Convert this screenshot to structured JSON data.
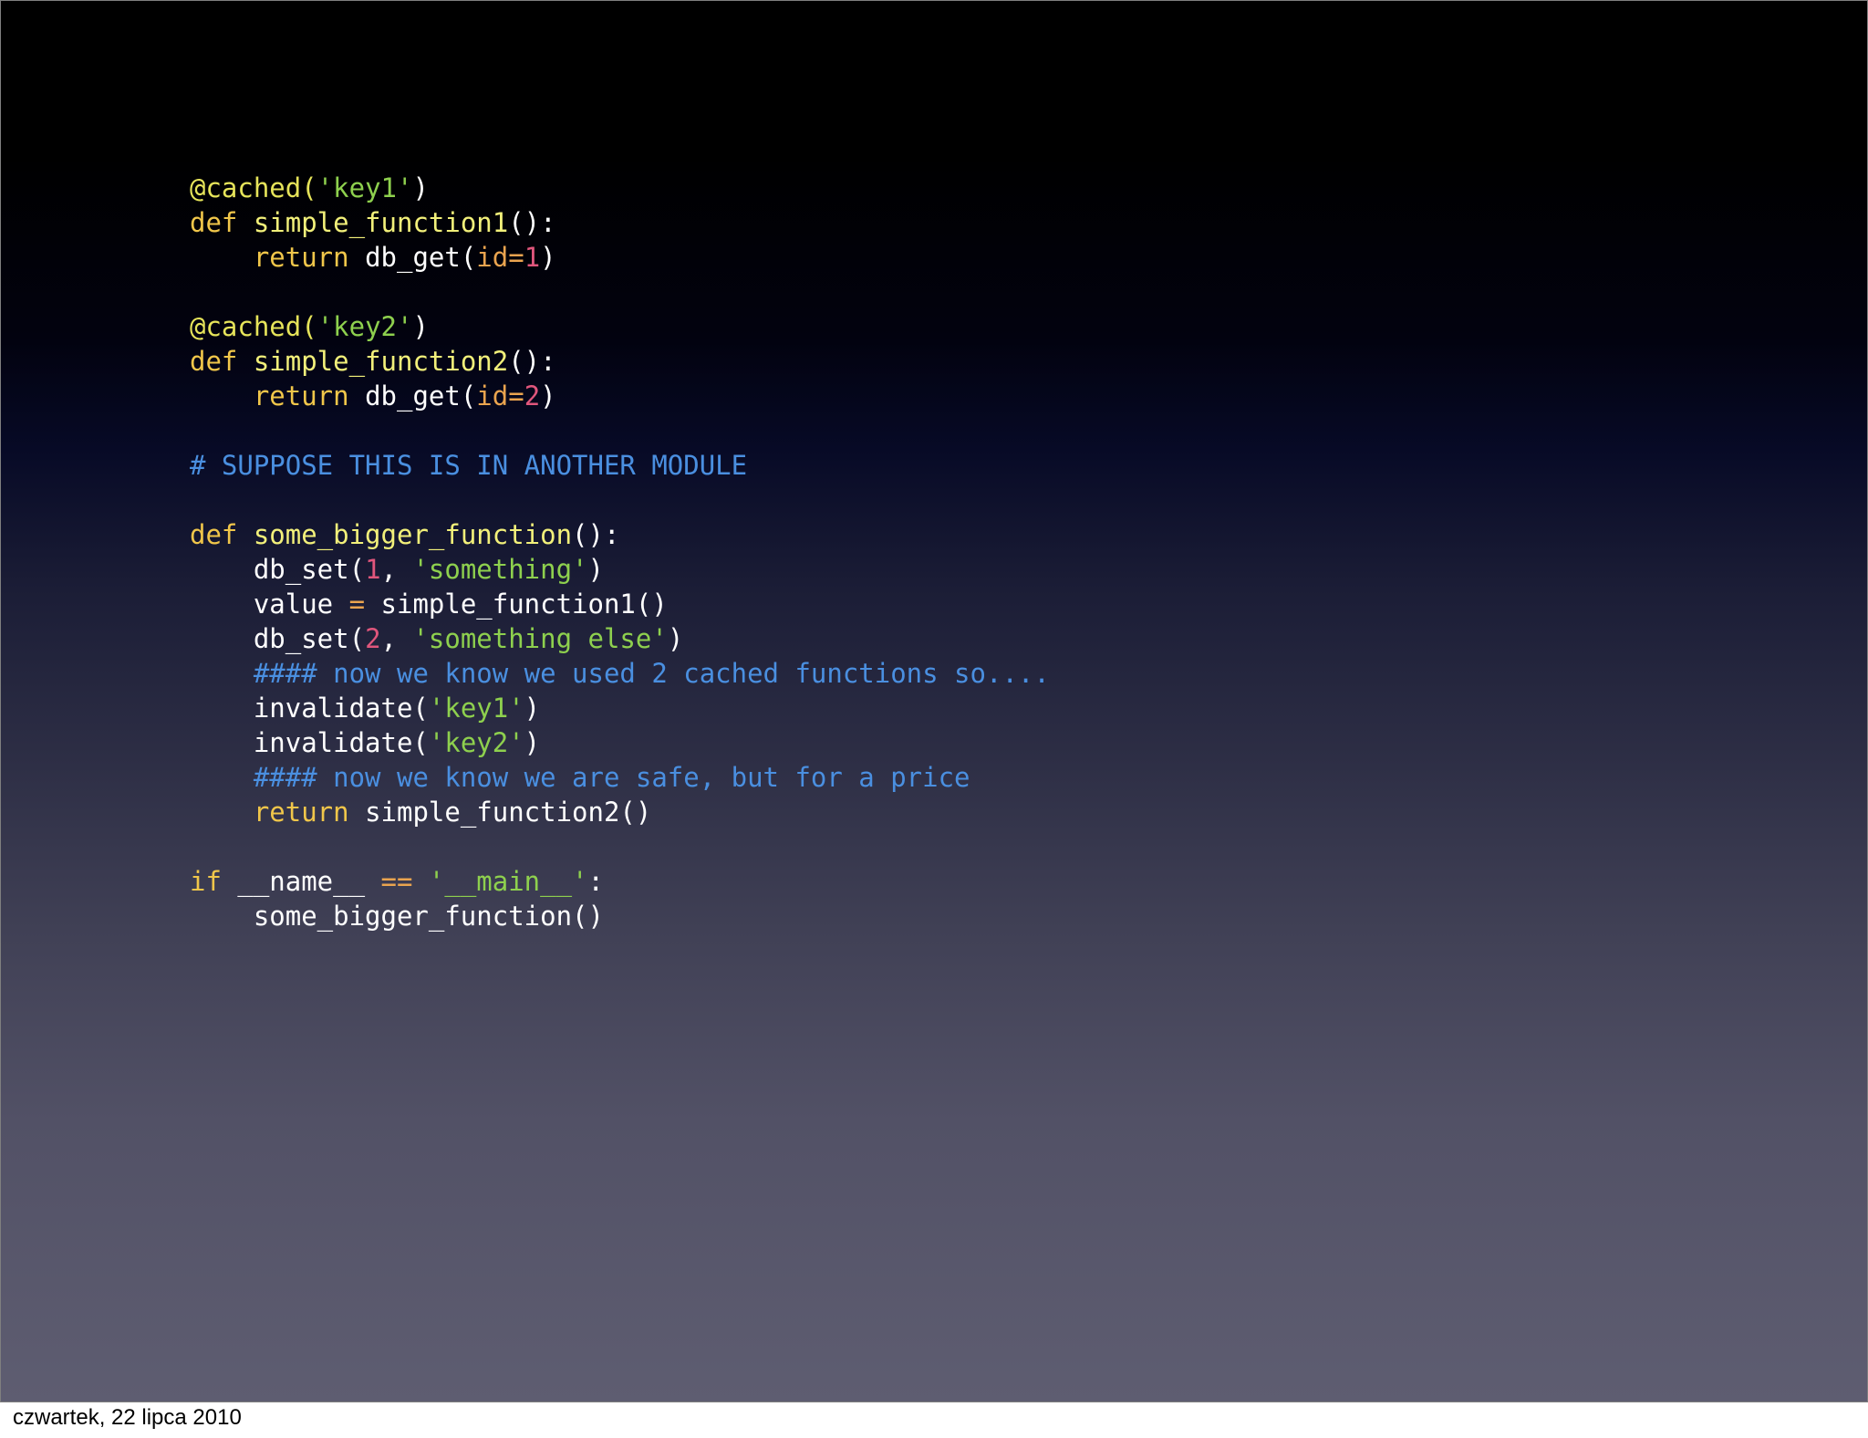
{
  "code_lines": [
    [
      {
        "t": "@cached(",
        "c": "decorator"
      },
      {
        "t": "'key1'",
        "c": "string"
      },
      {
        "t": ")",
        "c": "plain"
      }
    ],
    [
      {
        "t": "def ",
        "c": "keyword"
      },
      {
        "t": "simple_function1",
        "c": "funcdef"
      },
      {
        "t": "():",
        "c": "plain"
      }
    ],
    [
      {
        "t": "    ",
        "c": "plain"
      },
      {
        "t": "return",
        "c": "keyword"
      },
      {
        "t": " db_get(",
        "c": "plain"
      },
      {
        "t": "id=",
        "c": "param"
      },
      {
        "t": "1",
        "c": "number"
      },
      {
        "t": ")",
        "c": "plain"
      }
    ],
    [],
    [
      {
        "t": "@cached(",
        "c": "decorator"
      },
      {
        "t": "'key2'",
        "c": "string"
      },
      {
        "t": ")",
        "c": "plain"
      }
    ],
    [
      {
        "t": "def ",
        "c": "keyword"
      },
      {
        "t": "simple_function2",
        "c": "funcdef"
      },
      {
        "t": "():",
        "c": "plain"
      }
    ],
    [
      {
        "t": "    ",
        "c": "plain"
      },
      {
        "t": "return",
        "c": "keyword"
      },
      {
        "t": " db_get(",
        "c": "plain"
      },
      {
        "t": "id=",
        "c": "param"
      },
      {
        "t": "2",
        "c": "number"
      },
      {
        "t": ")",
        "c": "plain"
      }
    ],
    [],
    [
      {
        "t": "# SUPPOSE THIS IS IN ANOTHER MODULE",
        "c": "comment"
      }
    ],
    [],
    [
      {
        "t": "def ",
        "c": "keyword"
      },
      {
        "t": "some_bigger_function",
        "c": "funcdef"
      },
      {
        "t": "():",
        "c": "plain"
      }
    ],
    [
      {
        "t": "    db_set(",
        "c": "plain"
      },
      {
        "t": "1",
        "c": "number"
      },
      {
        "t": ", ",
        "c": "plain"
      },
      {
        "t": "'something'",
        "c": "string"
      },
      {
        "t": ")",
        "c": "plain"
      }
    ],
    [
      {
        "t": "    value ",
        "c": "plain"
      },
      {
        "t": "=",
        "c": "operator"
      },
      {
        "t": " simple_function1()",
        "c": "plain"
      }
    ],
    [
      {
        "t": "    db_set(",
        "c": "plain"
      },
      {
        "t": "2",
        "c": "number"
      },
      {
        "t": ", ",
        "c": "plain"
      },
      {
        "t": "'something else'",
        "c": "string"
      },
      {
        "t": ")",
        "c": "plain"
      }
    ],
    [
      {
        "t": "    ",
        "c": "plain"
      },
      {
        "t": "#### now we know we used 2 cached functions so....",
        "c": "comment"
      }
    ],
    [
      {
        "t": "    invalidate(",
        "c": "plain"
      },
      {
        "t": "'key1'",
        "c": "string"
      },
      {
        "t": ")",
        "c": "plain"
      }
    ],
    [
      {
        "t": "    invalidate(",
        "c": "plain"
      },
      {
        "t": "'key2'",
        "c": "string"
      },
      {
        "t": ")",
        "c": "plain"
      }
    ],
    [
      {
        "t": "    ",
        "c": "plain"
      },
      {
        "t": "#### now we know we are safe, but for a price",
        "c": "comment"
      }
    ],
    [
      {
        "t": "    ",
        "c": "plain"
      },
      {
        "t": "return",
        "c": "keyword"
      },
      {
        "t": " simple_function2()",
        "c": "plain"
      }
    ],
    [],
    [
      {
        "t": "if",
        "c": "keyword"
      },
      {
        "t": " __name__ ",
        "c": "plain"
      },
      {
        "t": "==",
        "c": "operator"
      },
      {
        "t": " ",
        "c": "plain"
      },
      {
        "t": "'__main__'",
        "c": "string"
      },
      {
        "t": ":",
        "c": "plain"
      }
    ],
    [
      {
        "t": "    some_bigger_function()",
        "c": "plain"
      }
    ]
  ],
  "footer": {
    "date_label": "czwartek, 22 lipca 2010"
  }
}
